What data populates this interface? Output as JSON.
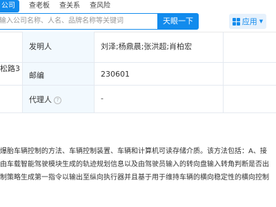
{
  "nav": {
    "tabs": [
      {
        "label": "查公司",
        "display": "公司"
      },
      {
        "label": "查老板"
      },
      {
        "label": "查关系"
      },
      {
        "label": "查风险"
      }
    ]
  },
  "search": {
    "placeholder": "输入公司名称、人名、品牌名称等关键词",
    "button_label": "天眼一下"
  },
  "apps": {
    "label": "应用"
  },
  "info": {
    "rows": [
      {
        "left": "",
        "label": "发明人",
        "value": "刘泽;杨鼎晨;张洪超;肖柏宏"
      },
      {
        "left": "松路3",
        "label": "邮编",
        "value": "230601"
      },
      {
        "left": "",
        "label": "代理人",
        "value": "-"
      }
    ]
  },
  "abstract": {
    "lines": [
      "爆胎车辆控制的方法、车辆控制装置、车辆和计算机可读存储介质。该方法包括：A、接",
      "由车载智能驾驶模块生成的轨迹规划信息以及由驾驶员输入的转向盘输入转角判断是否出",
      "制策略生成第一指令以输出至纵向执行器并且基于用于维持车辆的横向稳定性的横向控制"
    ]
  },
  "colors": {
    "accent": "#128bed",
    "label_bg": "#f2f9fe",
    "border": "#e4e9f0"
  }
}
